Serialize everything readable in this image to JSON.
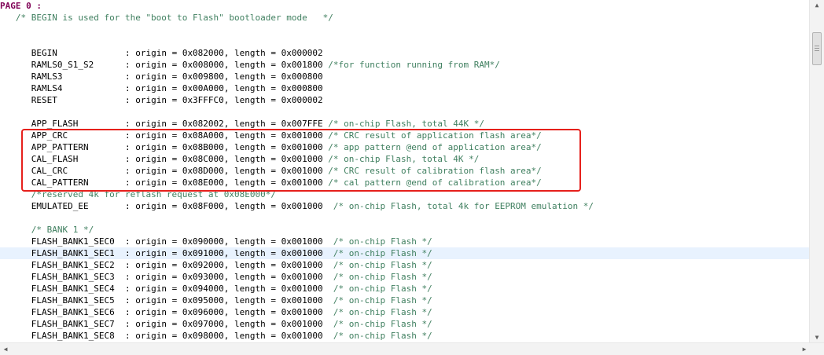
{
  "editor": {
    "header_keyword": "PAGE 0 :",
    "top_comment": "/* BEGIN is used for the \"boot to Flash\" bootloader mode   */",
    "lines": [
      {
        "name": "BEGIN",
        "def": ": origin = 0x082000, length = 0x000002",
        "comment": ""
      },
      {
        "name": "RAMLS0_S1_S2",
        "def": ": origin = 0x008000, length = 0x001800",
        "comment": "/*for function running from RAM*/"
      },
      {
        "name": "RAMLS3",
        "def": ": origin = 0x009800, length = 0x000800",
        "comment": ""
      },
      {
        "name": "RAMLS4",
        "def": ": origin = 0x00A000, length = 0x000800",
        "comment": ""
      },
      {
        "name": "RESET",
        "def": ": origin = 0x3FFFC0, length = 0x000002",
        "comment": ""
      },
      {
        "name": "APP_FLASH",
        "def": ": origin = 0x082002, length = 0x007FFE",
        "comment": "/* on-chip Flash, total 44K */"
      },
      {
        "name": "APP_CRC",
        "def": ": origin = 0x08A000, length = 0x001000",
        "comment": "/* CRC result of application flash area*/"
      },
      {
        "name": "APP_PATTERN",
        "def": ": origin = 0x08B000, length = 0x001000",
        "comment": "/* app pattern @end of application area*/"
      },
      {
        "name": "CAL_FLASH",
        "def": ": origin = 0x08C000, length = 0x001000",
        "comment": "/* on-chip Flash, total 4K */"
      },
      {
        "name": "CAL_CRC",
        "def": ": origin = 0x08D000, length = 0x001000",
        "comment": "/* CRC result of calibration flash area*/"
      },
      {
        "name": "CAL_PATTERN",
        "def": ": origin = 0x08E000, length = 0x001000",
        "comment": "/* cal pattern @end of calibration area*/"
      },
      {
        "name": "",
        "def": "",
        "comment": "/*reserved 4k for reflash request at 0x08E000*/"
      },
      {
        "name": "EMULATED_EE",
        "def": ": origin = 0x08F000, length = 0x001000",
        "comment": " /* on-chip Flash, total 4k for EEPROM emulation */"
      },
      {
        "name": "",
        "def": "",
        "comment": "/* BANK 1 */"
      },
      {
        "name": "FLASH_BANK1_SEC0",
        "def": ": origin = 0x090000, length = 0x001000",
        "comment": " /* on-chip Flash */"
      },
      {
        "name": "FLASH_BANK1_SEC1",
        "def": ": origin = 0x091000, length = 0x001000",
        "comment": " /* on-chip Flash */"
      },
      {
        "name": "FLASH_BANK1_SEC2",
        "def": ": origin = 0x092000, length = 0x001000",
        "comment": " /* on-chip Flash */"
      },
      {
        "name": "FLASH_BANK1_SEC3",
        "def": ": origin = 0x093000, length = 0x001000",
        "comment": " /* on-chip Flash */"
      },
      {
        "name": "FLASH_BANK1_SEC4",
        "def": ": origin = 0x094000, length = 0x001000",
        "comment": " /* on-chip Flash */"
      },
      {
        "name": "FLASH_BANK1_SEC5",
        "def": ": origin = 0x095000, length = 0x001000",
        "comment": " /* on-chip Flash */"
      },
      {
        "name": "FLASH_BANK1_SEC6",
        "def": ": origin = 0x096000, length = 0x001000",
        "comment": " /* on-chip Flash */"
      },
      {
        "name": "FLASH_BANK1_SEC7",
        "def": ": origin = 0x097000, length = 0x001000",
        "comment": " /* on-chip Flash */"
      },
      {
        "name": "FLASH_BANK1_SEC8",
        "def": ": origin = 0x098000, length = 0x001000",
        "comment": " /* on-chip Flash */"
      }
    ]
  },
  "colors": {
    "keyword": "#7f0055",
    "comment": "#3f7f5f",
    "highlight_box": "#e6201c",
    "current_line": "#e8f2fe"
  },
  "icons": {
    "scroll_up": "triangle-up",
    "scroll_down": "triangle-down",
    "scroll_left": "triangle-left",
    "scroll_right": "triangle-right"
  }
}
